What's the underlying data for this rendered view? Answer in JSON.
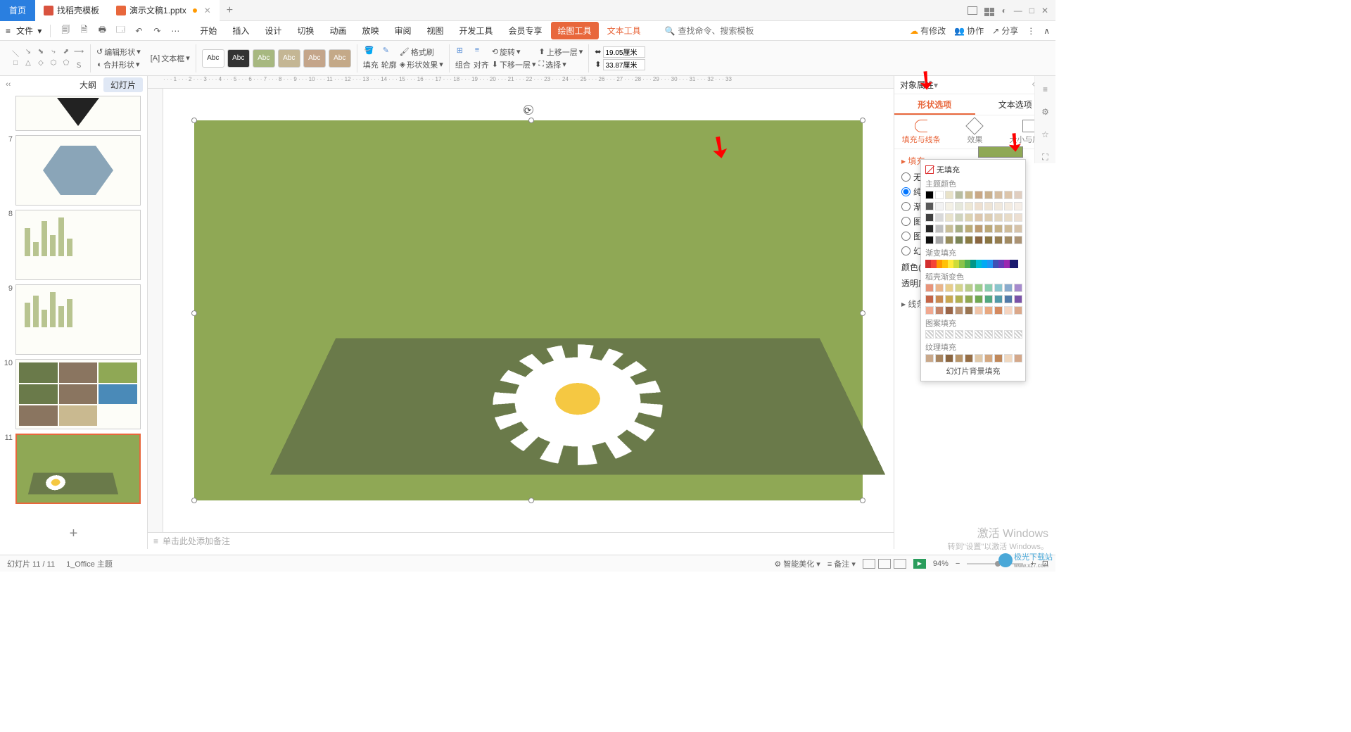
{
  "titleBar": {
    "home": "首页",
    "tab1": "找稻壳模板",
    "tab2": "演示文稿1.pptx"
  },
  "winCtrl": {
    "min": "—",
    "max": "□",
    "close": "✕"
  },
  "menu": {
    "file": "文件",
    "tabs": [
      "开始",
      "插入",
      "设计",
      "切换",
      "动画",
      "放映",
      "审阅",
      "视图",
      "开发工具",
      "会员专享"
    ],
    "drawTool": "绘图工具",
    "textTool": "文本工具",
    "searchPlaceholder": "查找命令、搜索模板",
    "right": {
      "pending": "有修改",
      "coop": "协作",
      "share": "分享"
    }
  },
  "ribbon": {
    "editShape": "编辑形状",
    "textBox": "文本框",
    "mergeShape": "合并形状",
    "abc": "Abc",
    "fill": "填充",
    "outline": "轮廓",
    "formatBrush": "格式刷",
    "shapeEffect": "形状效果",
    "combine": "组合",
    "align": "对齐",
    "rotate": "旋转",
    "moveUp": "上移一层",
    "moveDown": "下移一层",
    "select": "选择",
    "width": "19.05厘米",
    "height": "33.87厘米"
  },
  "side": {
    "outline": "大纲",
    "slides": "幻灯片",
    "nums": [
      "7",
      "8",
      "9",
      "10",
      "11"
    ]
  },
  "notes": "单击此处添加备注",
  "rightPanel": {
    "title": "对象属性",
    "tabShape": "形状选项",
    "tabText": "文本选项",
    "subFill": "填充与线条",
    "subEffect": "效果",
    "subSize": "大小与属性",
    "fillSection": "填充",
    "noFill": "无填充(N)",
    "solidFill": "纯色填充(S)",
    "gradFill": "渐变填充(G)",
    "picFill": "图片或纹理填充(P)",
    "patFill": "图案填充(A)",
    "bgFill": "幻灯片背景填充(B)",
    "color": "颜色(C)",
    "transparency": "透明度(T)",
    "lineSection": "线条"
  },
  "colorPopup": {
    "noFill": "无填充",
    "theme": "主题颜色",
    "gradient": "渐变填充",
    "daokeGrad": "稻壳渐变色",
    "pattern": "图案填充",
    "texture": "纹理填充",
    "slideBg": "幻灯片背景填充",
    "themeColors": [
      "#000000",
      "#ffffff",
      "#e8e2c8",
      "#b8bda0",
      "#c9b98f",
      "#c9a886",
      "#c9b08e",
      "#d4bca0",
      "#dcc5ab",
      "#e0cec0"
    ],
    "themeShades1": [
      "#595959",
      "#f2f2f2",
      "#f4f1e6",
      "#e6e8db",
      "#eee8d5",
      "#eee0d0",
      "#eee4d5",
      "#f0e8dc",
      "#f3ebe0",
      "#f5eee7"
    ],
    "themeShades2": [
      "#404040",
      "#d9d9d9",
      "#e9e3cc",
      "#d0d4bd",
      "#ddd3b2",
      "#ddc7ad",
      "#ddcdb2",
      "#e2d6c0",
      "#e8dcc8",
      "#ecdfd2"
    ],
    "themeShades3": [
      "#262626",
      "#bfbfbf",
      "#c9bf98",
      "#a6ae84",
      "#bcac78",
      "#bc9b71",
      "#bca878",
      "#c5b188",
      "#cfbc9a",
      "#d6c3aa"
    ],
    "themeShades4": [
      "#0d0d0d",
      "#a6a6a6",
      "#968c5a",
      "#7a8456",
      "#8a7a42",
      "#8a6640",
      "#8a7542",
      "#957d50",
      "#a18a62",
      "#ab9374"
    ],
    "gradColors": [
      "#d32f2f",
      "#f44336",
      "#ff9800",
      "#ffc107",
      "#ffeb3b",
      "#cddc39",
      "#8bc34a",
      "#4caf50",
      "#009688",
      "#00bcd4",
      "#03a9f4",
      "#2196f3",
      "#3f51b5",
      "#673ab7",
      "#9c27b0",
      "#1a1a6e"
    ],
    "daokeRow1": [
      "#e8947a",
      "#eab58a",
      "#e8cd8a",
      "#d4d48a",
      "#b8cd8a",
      "#9acd8a",
      "#8acdb0",
      "#8ac5cd",
      "#8aabcd",
      "#a68acd"
    ],
    "daokeRow2": [
      "#c56548",
      "#c98a52",
      "#c9a852",
      "#b0b052",
      "#8fa852",
      "#6fa852",
      "#52a880",
      "#529aa8",
      "#527aa8",
      "#7a52a8"
    ],
    "daokeRow3": [
      "#f0a890",
      "#c4856a",
      "#9a6548",
      "#b89070",
      "#9a7552",
      "#f0c4a8",
      "#e8a880",
      "#d48a60",
      "#f5d4c0",
      "#dba88a"
    ],
    "patterns": [
      "#fff",
      "#fff",
      "#fff",
      "#fff",
      "#fff",
      "#fff",
      "#fff",
      "#fff",
      "#fff",
      "#fff"
    ],
    "textures": [
      "#c9a88a",
      "#a88560",
      "#8a6540",
      "#b8956a",
      "#966e45",
      "#e0c8a8",
      "#d4a880",
      "#c0885a",
      "#f0d8c0",
      "#d4a88a"
    ]
  },
  "status": {
    "slideNum": "幻灯片 11 / 11",
    "theme": "1_Office 主题",
    "beautify": "智能美化",
    "notes": "备注",
    "zoom": "94%"
  },
  "watermark": {
    "title": "激活 Windows",
    "sub": "转到\"设置\"以激活 Windows。"
  },
  "logo": "极光下载站",
  "logoUrl": "www.xz7.com"
}
